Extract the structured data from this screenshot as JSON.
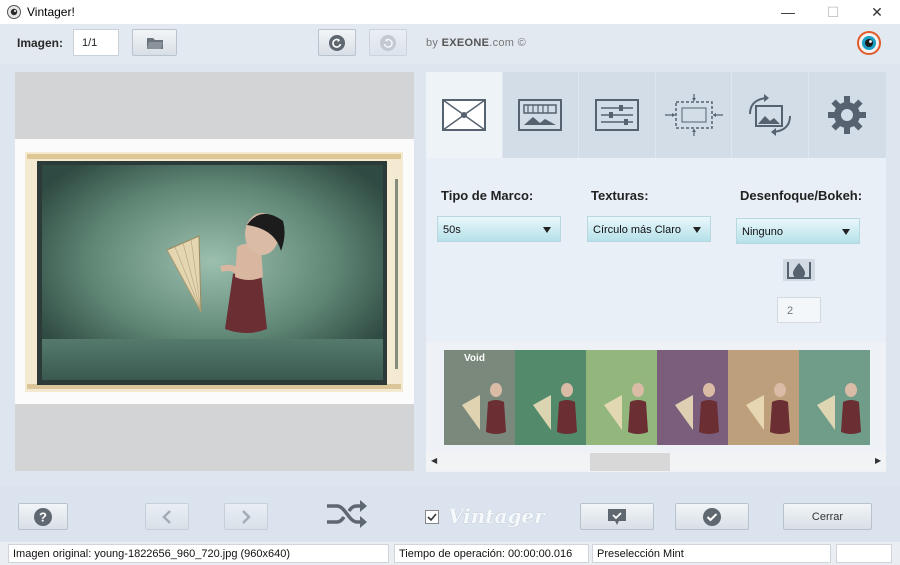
{
  "window": {
    "title": "Vintager!",
    "minimize_glyph": "—",
    "maximize_glyph": "☐",
    "close_glyph": "✕"
  },
  "toolbar": {
    "image_label": "Imagen:",
    "image_counter": "1/1",
    "brand_prefix": "by",
    "brand_name": "EXEONE",
    "brand_suffix": ".com ©"
  },
  "options": {
    "tabs": [
      "frame-icon",
      "texture-icon",
      "adjust-icon",
      "crop-icon",
      "rotate-icon",
      "settings-icon"
    ],
    "frame_type_label": "Tipo de Marco:",
    "frame_type_value": "50s",
    "textures_label": "Texturas:",
    "textures_value": "Círculo más Claro",
    "blur_label": "Desenfoque/Bokeh:",
    "blur_value": "Ninguno",
    "blur_amount": "2"
  },
  "presets": {
    "items": [
      {
        "label": "Void",
        "tint": "#8b9c8c"
      },
      {
        "label": "",
        "tint": "#5f9e7a"
      },
      {
        "label": "",
        "tint": "#a8d08f"
      },
      {
        "label": "",
        "tint": "#8c6b8e"
      },
      {
        "label": "",
        "tint": "#d9b58c"
      },
      {
        "label": "",
        "tint": "#7fb39d"
      }
    ]
  },
  "bottom": {
    "help_label": "?",
    "vintager_checkbox_checked": true,
    "vintager_logo_text": "Vintager",
    "close_label": "Cerrar"
  },
  "status": {
    "original": "Imagen original: young-1822656_960_720.jpg (960x640)",
    "time": "Tiempo de operación: 00:00:00.016",
    "preset": "Preselección Mint",
    "extra": ""
  }
}
